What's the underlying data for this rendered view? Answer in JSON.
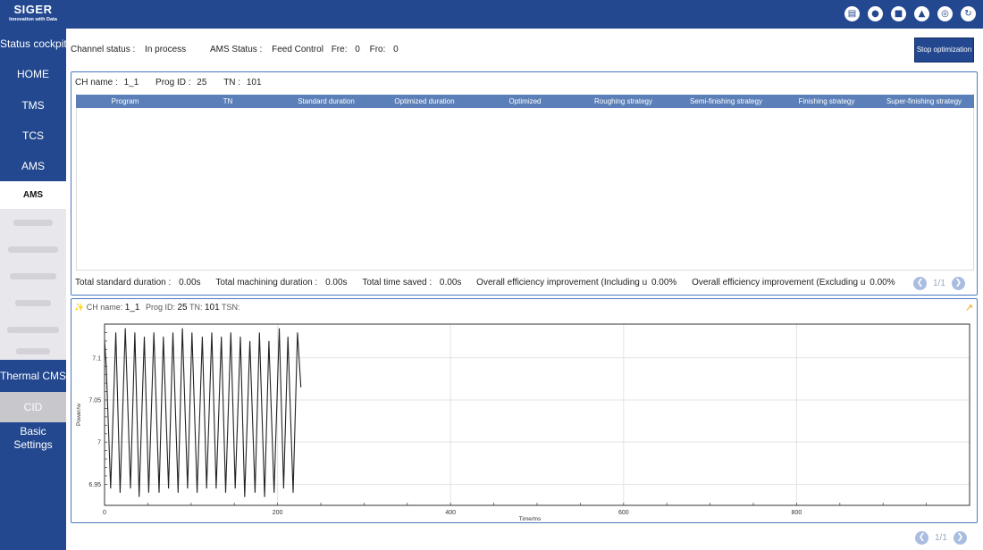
{
  "brand": {
    "name": "SIGER",
    "tagline": "Innovation with Data"
  },
  "top_icons": [
    "chart-icon",
    "user-icon",
    "shirt-icon",
    "bell-icon",
    "target-icon",
    "refresh-icon"
  ],
  "sidebar": {
    "items": [
      {
        "label": "Status cockpit"
      },
      {
        "label": "HOME"
      },
      {
        "label": "TMS"
      },
      {
        "label": "TCS"
      },
      {
        "label": "AMS"
      }
    ],
    "active_sub": "AMS",
    "bottom": [
      {
        "label": "Thermal CMS"
      },
      {
        "label": "CID"
      }
    ],
    "basic_settings": {
      "line1": "Basic",
      "line2": "Settings"
    }
  },
  "status": {
    "channel_label": "Channel status :",
    "channel_value": "In process",
    "ams_label": "AMS Status :",
    "ams_value": "Feed Control",
    "fre_label": "Fre:",
    "fre_value": "0",
    "fro_label": "Fro:",
    "fro_value": "0",
    "stop_button": "Stop optimization"
  },
  "table": {
    "ch_name_label": "CH name :",
    "ch_name_value": "1_1",
    "prog_label": "Prog ID :",
    "prog_value": "25",
    "tn_label": "TN :",
    "tn_value": "101",
    "columns": [
      "Program",
      "TN",
      "Standard duration",
      "Optimized duration",
      "Optimized",
      "Roughing strategy",
      "Semi-finishing strategy",
      "Finishing strategy",
      "Super-finishing strategy"
    ],
    "rows": [],
    "summary": {
      "std_label": "Total standard duration :",
      "std_value": "0.00s",
      "mach_label": "Total machining duration :",
      "mach_value": "0.00s",
      "saved_label": "Total time saved :",
      "saved_value": "0.00s",
      "eff_incl_label": "Overall efficiency improvement (Including u",
      "eff_incl_value": "0.00%",
      "eff_excl_label": "Overall efficiency improvement (Excluding u",
      "eff_excl_value": "0.00%"
    },
    "pager": "1/1"
  },
  "chart_panel": {
    "ch_name_label": "CH name:",
    "ch_name_value": "1_1",
    "prog_label": "Prog ID:",
    "prog_value": "25",
    "tn_label": "TN:",
    "tn_value": "101",
    "tsn_label": "TSN:"
  },
  "chart_data": {
    "type": "line",
    "xlabel": "Time/ms",
    "ylabel": "Power/w",
    "xlim": [
      0,
      1000
    ],
    "ylim": [
      6.925,
      7.14
    ],
    "xticks": [
      0,
      200,
      400,
      600,
      800
    ],
    "yticks": [
      6.95,
      7,
      7.05,
      7.1
    ],
    "grid": true,
    "series": [
      {
        "color": "#222222",
        "x": [
          0,
          2,
          7,
          13,
          18,
          24,
          30,
          35,
          40,
          46,
          51,
          57,
          63,
          68,
          74,
          79,
          85,
          90,
          96,
          101,
          107,
          113,
          118,
          124,
          129,
          135,
          140,
          146,
          151,
          157,
          162,
          168,
          174,
          179,
          185,
          190,
          196,
          202,
          207,
          212,
          218,
          223,
          227
        ],
        "y": [
          7.12,
          7.09,
          6.945,
          7.13,
          6.94,
          7.135,
          6.945,
          7.13,
          6.935,
          7.125,
          6.94,
          7.13,
          6.94,
          7.125,
          6.945,
          7.13,
          6.94,
          7.135,
          6.945,
          7.13,
          6.94,
          7.125,
          6.945,
          7.13,
          6.945,
          7.125,
          6.94,
          7.13,
          6.945,
          7.125,
          6.935,
          7.12,
          6.94,
          7.13,
          6.935,
          7.12,
          6.94,
          7.135,
          6.945,
          7.125,
          6.94,
          7.13,
          7.065
        ]
      }
    ]
  },
  "bottom_pager": "1/1"
}
